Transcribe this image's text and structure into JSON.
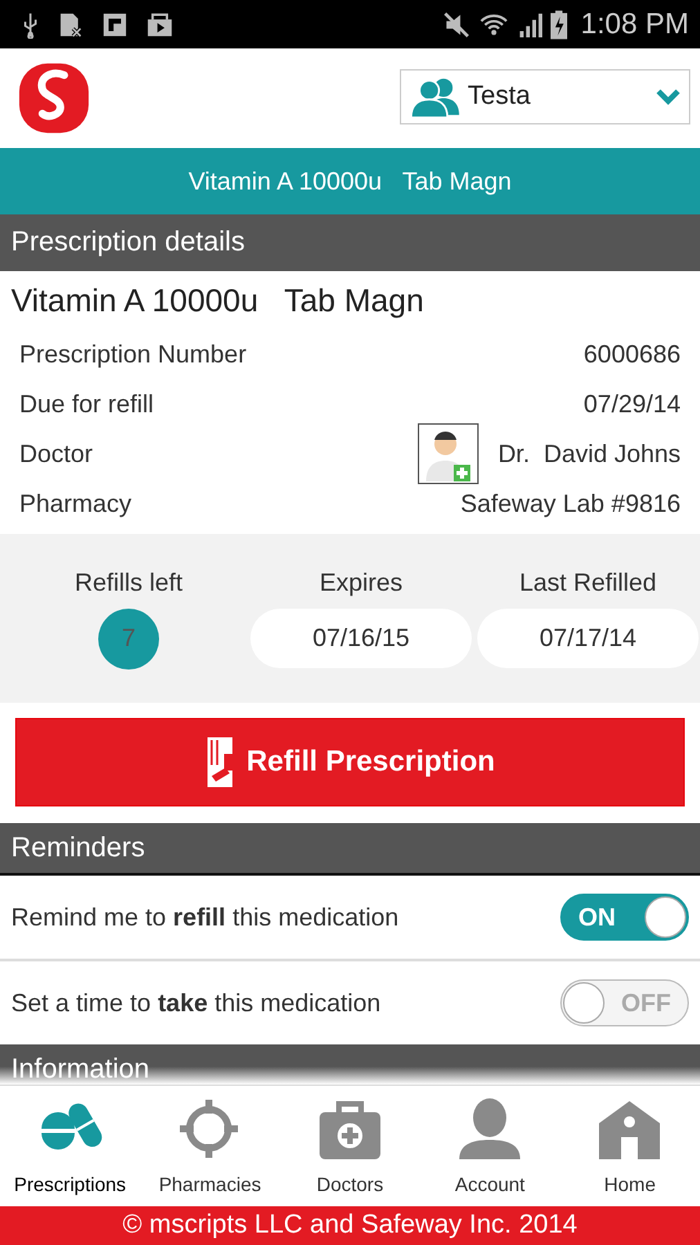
{
  "status_bar": {
    "time": "1:08 PM"
  },
  "header": {
    "profile": {
      "name": "Testa"
    }
  },
  "banner": {
    "title": "Vitamin A 10000u   Tab Magn"
  },
  "details": {
    "heading": "Prescription details",
    "drug": "Vitamin A 10000u   Tab Magn",
    "rows": [
      {
        "kind": "text",
        "label": "Prescription Number",
        "value": "6000686"
      },
      {
        "kind": "text",
        "label": "Due for refill",
        "value": "07/29/14"
      },
      {
        "kind": "doctor",
        "label": "Doctor",
        "value": "Dr.  David Johns"
      },
      {
        "kind": "text",
        "label": "Pharmacy",
        "value": "Safeway Lab #9816"
      }
    ]
  },
  "stats": [
    {
      "kind": "count",
      "label": "Refills left",
      "value": "7"
    },
    {
      "kind": "date",
      "label": "Expires",
      "value": "07/16/15"
    },
    {
      "kind": "date",
      "label": "Last Refilled",
      "value": "07/17/14"
    }
  ],
  "refill_button": {
    "label": "Refill Prescription"
  },
  "reminders": {
    "heading": "Reminders",
    "items": [
      {
        "text": "Remind me to **refill** this medication",
        "on": true,
        "switch_label": "ON"
      },
      {
        "text": "Set a time to **take** this medication",
        "on": false,
        "switch_label": "OFF"
      }
    ]
  },
  "information": {
    "heading": "Information"
  },
  "nav": [
    {
      "kind": "pills",
      "label": "Prescriptions",
      "selected": true
    },
    {
      "kind": "target",
      "label": "Pharmacies",
      "selected": false
    },
    {
      "kind": "kit",
      "label": "Doctors",
      "selected": false
    },
    {
      "kind": "person",
      "label": "Account",
      "selected": false
    },
    {
      "kind": "house",
      "label": "Home",
      "selected": false
    }
  ],
  "footer": {
    "text": "© mscripts LLC and Safeway Inc. 2014"
  }
}
